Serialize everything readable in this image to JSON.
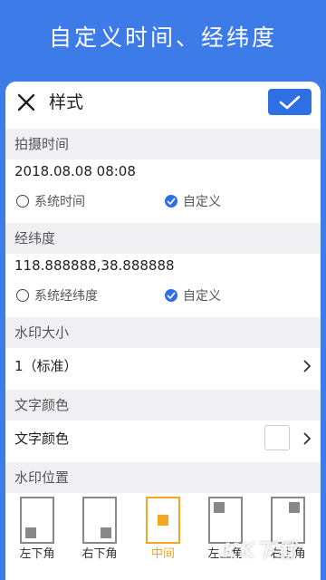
{
  "banner": {
    "title": "自定义时间、经纬度"
  },
  "topbar": {
    "title": "样式",
    "close_icon": "close-icon",
    "confirm_icon": "checkmark-icon",
    "accent": "#2f6fe4"
  },
  "capture_time": {
    "header": "拍摄时间",
    "value": "2018.08.08 08:08",
    "option_system": "系统时间",
    "option_custom": "自定义",
    "selected": "custom"
  },
  "coordinates": {
    "header": "经纬度",
    "value": "118.888888,38.888888",
    "option_system": "系统经纬度",
    "option_custom": "自定义",
    "selected": "custom"
  },
  "watermark_size": {
    "header": "水印大小",
    "value": "1（标准）"
  },
  "text_color": {
    "header": "文字颜色",
    "label": "文字颜色",
    "swatch_color": "#ffffff"
  },
  "watermark_position": {
    "header": "水印位置",
    "options": [
      "左下角",
      "右下角",
      "中间",
      "左上角",
      "右上角"
    ],
    "selected_index": 2,
    "selected_color": "#f5a623"
  },
  "overlay": {
    "watermark_text": "KK下载"
  }
}
